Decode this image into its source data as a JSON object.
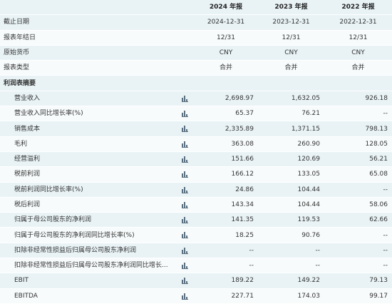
{
  "header": {
    "years": [
      "2024 年报",
      "2023 年报",
      "2022 年报"
    ]
  },
  "meta_rows": [
    {
      "label": "截止日期",
      "values": [
        "2024-12-31",
        "2023-12-31",
        "2022-12-31"
      ]
    },
    {
      "label": "报表年结日",
      "values": [
        "12/31",
        "12/31",
        "12/31"
      ]
    },
    {
      "label": "原始货币",
      "values": [
        "CNY",
        "CNY",
        "CNY"
      ]
    },
    {
      "label": "报表类型",
      "values": [
        "合并",
        "合并",
        "合并"
      ]
    }
  ],
  "section_title": "利润表摘要",
  "metrics": [
    {
      "label": "营业收入",
      "values": [
        "2,698.97",
        "1,632.05",
        "926.18"
      ],
      "chart_icon": "bar-chart-icon"
    },
    {
      "label": "营业收入同比增长率(%)",
      "values": [
        "65.37",
        "76.21",
        "--"
      ],
      "chart_icon": "bar-chart-icon"
    },
    {
      "label": "销售成本",
      "values": [
        "2,335.89",
        "1,371.15",
        "798.13"
      ],
      "chart_icon": "bar-chart-icon"
    },
    {
      "label": "毛利",
      "values": [
        "363.08",
        "260.90",
        "128.05"
      ],
      "chart_icon": "bar-chart-icon"
    },
    {
      "label": "经营溢利",
      "values": [
        "151.66",
        "120.69",
        "56.21"
      ],
      "chart_icon": "bar-chart-icon"
    },
    {
      "label": "税前利润",
      "values": [
        "166.12",
        "133.05",
        "65.08"
      ],
      "chart_icon": "bar-chart-icon"
    },
    {
      "label": "税前利润同比增长率(%)",
      "values": [
        "24.86",
        "104.44",
        "--"
      ],
      "chart_icon": "bar-chart-icon"
    },
    {
      "label": "税后利润",
      "values": [
        "143.34",
        "104.44",
        "58.06"
      ],
      "chart_icon": "bar-chart-icon"
    },
    {
      "label": "归属于母公司股东的净利润",
      "values": [
        "141.35",
        "119.53",
        "62.66"
      ],
      "chart_icon": "bar-chart-icon"
    },
    {
      "label": "归属于母公司股东的净利润同比增长率(%)",
      "values": [
        "18.25",
        "90.76",
        "--"
      ],
      "chart_icon": "bar-chart-icon"
    },
    {
      "label": "扣除非经常性损益后归属母公司股东净利润",
      "values": [
        "--",
        "--",
        "--"
      ],
      "chart_icon": "bar-chart-icon"
    },
    {
      "label": "扣除非经常性损益后归属母公司股东净利润同比增长...",
      "values": [
        "--",
        "--",
        "--"
      ],
      "chart_icon": "bar-chart-icon"
    },
    {
      "label": "EBIT",
      "values": [
        "189.22",
        "149.22",
        "79.13"
      ],
      "chart_icon": "bar-chart-icon"
    },
    {
      "label": "EBITDA",
      "values": [
        "227.71",
        "174.03",
        "99.17"
      ],
      "chart_icon": "bar-chart-icon"
    }
  ]
}
